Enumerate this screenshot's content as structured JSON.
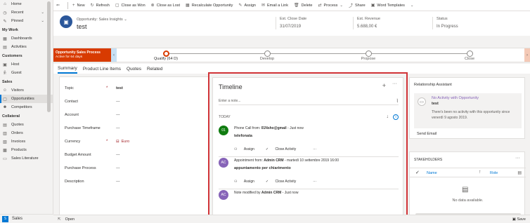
{
  "sidebar": {
    "items_top": [
      {
        "label": "Home",
        "icon": "home-icon",
        "glyph": "⌂"
      },
      {
        "label": "Recent",
        "icon": "clock-icon",
        "glyph": "◷"
      },
      {
        "label": "Pinned",
        "icon": "pin-icon",
        "glyph": "✎"
      }
    ],
    "groups": [
      {
        "title": "My Work",
        "items": [
          {
            "label": "Dashboards",
            "glyph": "▦"
          },
          {
            "label": "Activities",
            "glyph": "▤"
          }
        ]
      },
      {
        "title": "Customers",
        "items": [
          {
            "label": "Host",
            "glyph": "▣"
          },
          {
            "label": "Guest",
            "glyph": "ꆜ"
          }
        ]
      },
      {
        "title": "Sales",
        "items": [
          {
            "label": "Visitors",
            "glyph": "☺"
          },
          {
            "label": "Opportunities",
            "glyph": "▢"
          },
          {
            "label": "Competitors",
            "glyph": "☻"
          }
        ]
      },
      {
        "title": "Collateral",
        "items": [
          {
            "label": "Quotes",
            "glyph": "▤"
          },
          {
            "label": "Orders",
            "glyph": "▥"
          },
          {
            "label": "Invoices",
            "glyph": "▧"
          },
          {
            "label": "Products",
            "glyph": "▩"
          },
          {
            "label": "Sales Literature",
            "glyph": "▭"
          }
        ]
      }
    ],
    "footer": {
      "badge": "S",
      "label": "Sales"
    }
  },
  "commands": [
    {
      "label": "New",
      "glyph": "+"
    },
    {
      "label": "Refresh",
      "glyph": "↻"
    },
    {
      "label": "Close as Won",
      "glyph": "▢"
    },
    {
      "label": "Close as Lost",
      "glyph": "⊗"
    },
    {
      "label": "Recalculate Opportunity",
      "glyph": "▦"
    },
    {
      "label": "Assign",
      "glyph": "✎"
    },
    {
      "label": "Email a Link",
      "glyph": "✉"
    },
    {
      "label": "Delete",
      "glyph": "🗑"
    },
    {
      "label": "Process",
      "glyph": "⇄"
    },
    {
      "label": "Share",
      "glyph": "⤴"
    },
    {
      "label": "Word Templates",
      "glyph": "▣"
    }
  ],
  "header": {
    "form_name": "Opportunity: Sales Insights",
    "title": "test",
    "close_date_label": "Est. Close Date",
    "close_date": "31/07/2019",
    "revenue_label": "Est. Revenue",
    "revenue": "5.688,00 €",
    "status_label": "Status",
    "status": "In Progress"
  },
  "process": {
    "name": "Opportunity Sales Process",
    "active": "Active for 64 days",
    "stages": [
      {
        "name": "Qualify  (64 D)",
        "current": true
      },
      {
        "name": "Develop",
        "current": false
      },
      {
        "name": "Propose",
        "current": false
      },
      {
        "name": "Close",
        "current": false
      }
    ]
  },
  "tabs": [
    "Summary",
    "Product Line Items",
    "Quotes",
    "Related"
  ],
  "form": [
    {
      "label": "Topic",
      "required": true,
      "value": "test",
      "style": "bold"
    },
    {
      "label": "Contact",
      "required": false,
      "value": "---",
      "style": ""
    },
    {
      "label": "Account",
      "required": false,
      "value": "---",
      "style": ""
    },
    {
      "label": "Purchase Timeframe",
      "required": false,
      "value": "---",
      "style": ""
    },
    {
      "label": "Currency",
      "required": true,
      "value": "Euro",
      "style": "red"
    },
    {
      "label": "Budget Amount",
      "required": false,
      "value": "---",
      "style": ""
    },
    {
      "label": "Purchase Process",
      "required": false,
      "value": "---",
      "style": ""
    },
    {
      "label": "Description",
      "required": false,
      "value": "---",
      "style": ""
    }
  ],
  "timeline": {
    "title": "Timeline",
    "note_placeholder": "Enter a note...",
    "today": "TODAY",
    "activities": [
      {
        "avatar": "01",
        "avatar_color": "#107c10",
        "line_prefix": "Phone Call from: ",
        "who": "01Nsho@gmail",
        "time": " - Just now",
        "subject": "telefonata",
        "actions": [
          "Assign",
          "Close Activity",
          "···"
        ]
      },
      {
        "avatar": "AC",
        "avatar_color": "#8764b8",
        "line_prefix": "Appointment from: ",
        "who": "Admin CRM",
        "time": " - martedì 10 settembre 2019 16:00",
        "subject": "appuntamento per chiarimento",
        "actions": [
          "Assign",
          "Close Activity",
          "···"
        ]
      },
      {
        "avatar": "AC",
        "avatar_color": "#8764b8",
        "line_prefix": "Note modified by ",
        "who": "Admin CRM",
        "time": " - Just now",
        "subject": "",
        "actions": []
      }
    ]
  },
  "assistant": {
    "title": "Relationship Assistant",
    "card_title": "No Activity with Opportunity",
    "card_name": "test",
    "card_body": "There's been no activity with this opportunity since venerdì 9 agosto 2019.",
    "send": "Send Email"
  },
  "stakeholders": {
    "title": "STAKEHOLDERS",
    "col_name": "Name",
    "col_role": "Role",
    "empty": "No data available."
  },
  "statusbar": {
    "open": "Open",
    "save": "Save"
  }
}
